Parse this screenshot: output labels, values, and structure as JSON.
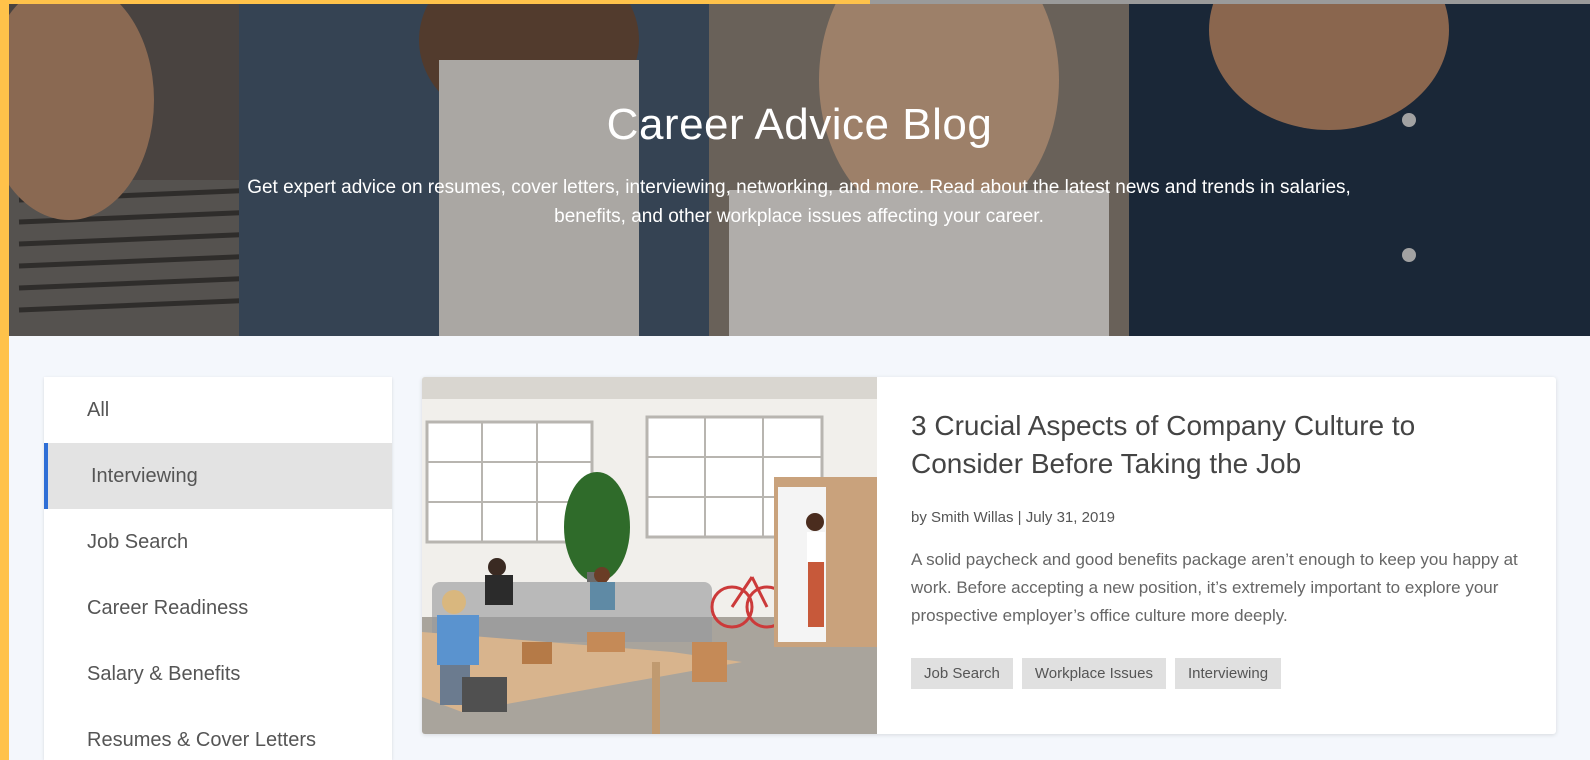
{
  "hero": {
    "title": "Career Advice Blog",
    "subtitle": "Get expert advice on resumes, cover letters, interviewing, networking, and more. Read about the latest news and trends in salaries, benefits, and other workplace issues affecting your career."
  },
  "sidebar": {
    "items": [
      {
        "label": "All",
        "active": false
      },
      {
        "label": "Interviewing",
        "active": true
      },
      {
        "label": "Job Search",
        "active": false
      },
      {
        "label": "Career Readiness",
        "active": false
      },
      {
        "label": "Salary & Benefits",
        "active": false
      },
      {
        "label": "Resumes & Cover Letters",
        "active": false
      }
    ]
  },
  "article": {
    "title": "3 Crucial Aspects of Company Culture to Consider Before Taking the Job",
    "meta": "by Smith Willas | July 31, 2019",
    "excerpt": "A solid paycheck and good benefits package aren’t enough to keep you happy at work. Before accepting a new position, it’s extremely important to explore your prospective employer’s office culture more deeply.",
    "tags": [
      "Job Search",
      "Workplace Issues",
      "Interviewing"
    ]
  },
  "colors": {
    "accent": "#2f6fd6",
    "frame": "#ffc24a",
    "active_bg": "#e3e3e3",
    "tag_bg": "#e0e0e0"
  }
}
